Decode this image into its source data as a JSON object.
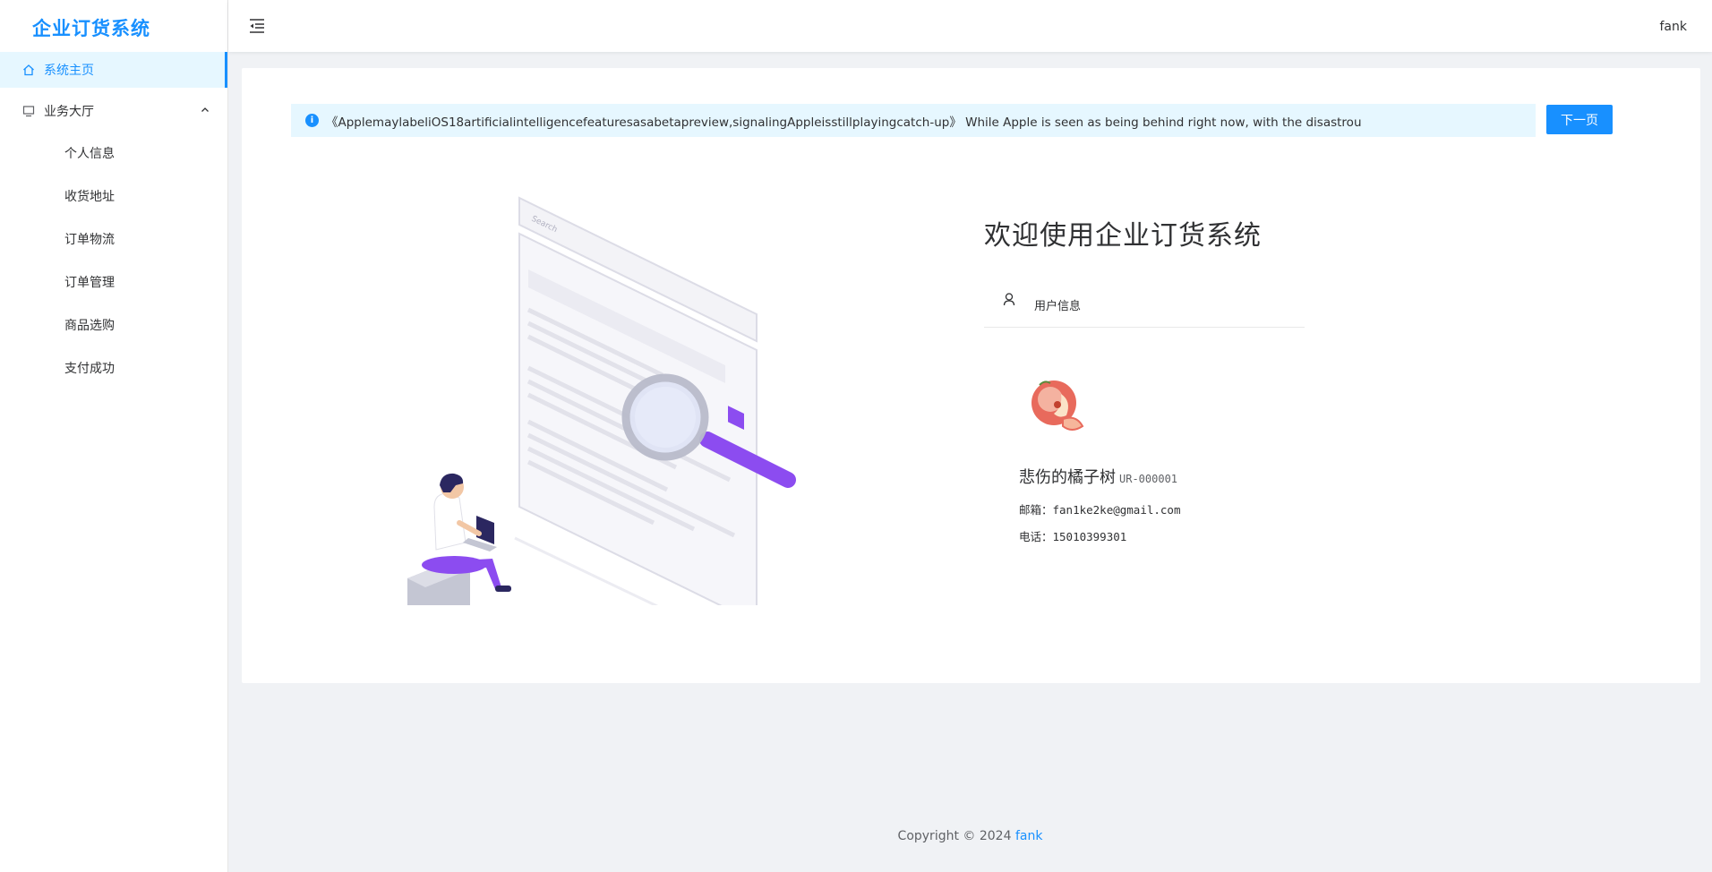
{
  "app": {
    "title": "企业订货系统"
  },
  "sidebar": {
    "home": "系统主页",
    "group": "业务大厅",
    "items": [
      "个人信息",
      "收货地址",
      "订单物流",
      "订单管理",
      "商品选购",
      "支付成功"
    ]
  },
  "topbar": {
    "username": "fank"
  },
  "notice": {
    "text": "《ApplemaylabeliOS18artificialintelligencefeaturesasabetapreview,signalingAppleisstillplayingcatch-up》 While Apple is seen as being behind right now, with the disastrou",
    "next_label": "下一页"
  },
  "illustration": {
    "search_placeholder": "Search"
  },
  "welcome": {
    "title": "欢迎使用企业订货系统"
  },
  "user_panel": {
    "tab_label": "用户信息",
    "name": "悲伤的橘子树",
    "id": "UR-000001",
    "email_line": "邮箱：fan1ke2ke@gmail.com",
    "phone_line": "电话：15010399301"
  },
  "footer": {
    "copyright": "Copyright © 2024",
    "author": "fank"
  },
  "colors": {
    "primary": "#1890ff",
    "notice_bg": "#e6f7ff",
    "page_bg": "#f0f2f5",
    "accent_purple": "#8c4cf0"
  }
}
